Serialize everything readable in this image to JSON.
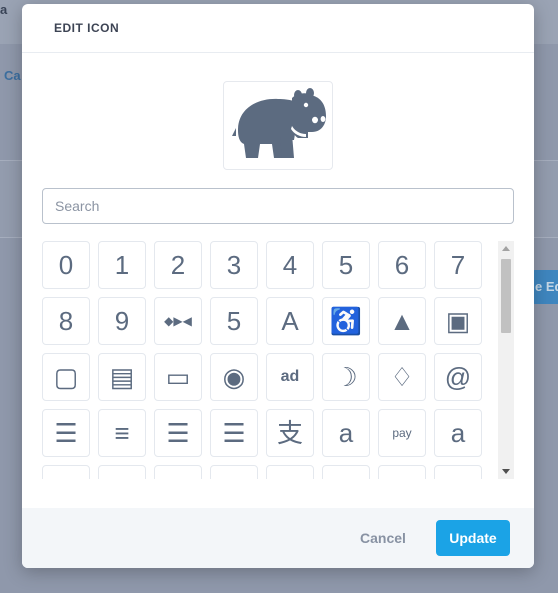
{
  "background": {
    "left_text": "a",
    "cal_text": "Ca",
    "edit_button_text": "e Ed"
  },
  "modal": {
    "title": "EDIT ICON",
    "preview_icon": "hippo-icon",
    "search": {
      "placeholder": "Search",
      "value": ""
    },
    "icons": [
      {
        "name": "digit-0-icon",
        "glyph": "0",
        "kind": "g"
      },
      {
        "name": "digit-1-icon",
        "glyph": "1",
        "kind": "g"
      },
      {
        "name": "digit-2-icon",
        "glyph": "2",
        "kind": "g"
      },
      {
        "name": "digit-3-icon",
        "glyph": "3",
        "kind": "g"
      },
      {
        "name": "digit-4-icon",
        "glyph": "4",
        "kind": "g"
      },
      {
        "name": "digit-5-icon",
        "glyph": "5",
        "kind": "g"
      },
      {
        "name": "digit-6-icon",
        "glyph": "6",
        "kind": "g"
      },
      {
        "name": "digit-7-icon",
        "glyph": "7",
        "kind": "g"
      },
      {
        "name": "digit-8-icon",
        "glyph": "8",
        "kind": "g"
      },
      {
        "name": "digit-9-icon",
        "glyph": "9",
        "kind": "g"
      },
      {
        "name": "42-group-icon",
        "glyph": "◆▶◀",
        "kind": "s"
      },
      {
        "name": "500px-icon",
        "glyph": "5",
        "kind": "g"
      },
      {
        "name": "letter-a-icon",
        "glyph": "A",
        "kind": "g"
      },
      {
        "name": "accessible-icon",
        "glyph": "♿",
        "kind": "g"
      },
      {
        "name": "accusoft-icon",
        "glyph": "▲",
        "kind": "g"
      },
      {
        "name": "address-book-icon",
        "glyph": "▣",
        "kind": "g"
      },
      {
        "name": "address-book-outline-icon",
        "glyph": "▢",
        "kind": "g"
      },
      {
        "name": "address-card-icon",
        "glyph": "▤",
        "kind": "g"
      },
      {
        "name": "address-card-outline-icon",
        "glyph": "▭",
        "kind": "g"
      },
      {
        "name": "adn-icon",
        "glyph": "◉",
        "kind": "g"
      },
      {
        "name": "adversal-icon",
        "glyph": "ad",
        "kind": "t"
      },
      {
        "name": "affiliatetheme-icon",
        "glyph": "☽",
        "kind": "g"
      },
      {
        "name": "airbnb-icon",
        "glyph": "♢",
        "kind": "g"
      },
      {
        "name": "algolia-icon",
        "glyph": "@",
        "kind": "g"
      },
      {
        "name": "align-center-icon",
        "glyph": "☰",
        "kind": "g"
      },
      {
        "name": "align-justify-icon",
        "glyph": "≡",
        "kind": "g"
      },
      {
        "name": "align-left-icon",
        "glyph": "☰",
        "kind": "g"
      },
      {
        "name": "align-right-icon",
        "glyph": "☰",
        "kind": "g"
      },
      {
        "name": "alipay-icon",
        "glyph": "支",
        "kind": "g"
      },
      {
        "name": "amazon-icon",
        "glyph": "a",
        "kind": "g"
      },
      {
        "name": "amazon-pay-icon",
        "glyph": "pay",
        "kind": "s"
      },
      {
        "name": "letter-a-bold-icon",
        "glyph": "a",
        "kind": "g"
      },
      {
        "name": "partial-icon",
        "glyph": "•",
        "kind": "g"
      },
      {
        "name": "partial-icon",
        "glyph": "•",
        "kind": "g"
      },
      {
        "name": "partial-icon",
        "glyph": "•",
        "kind": "g"
      },
      {
        "name": "partial-icon",
        "glyph": "•",
        "kind": "g"
      },
      {
        "name": "partial-icon",
        "glyph": "•",
        "kind": "g"
      },
      {
        "name": "partial-icon",
        "glyph": "",
        "kind": "g"
      },
      {
        "name": "partial-icon",
        "glyph": "",
        "kind": "g"
      },
      {
        "name": "partial-icon",
        "glyph": "",
        "kind": "g"
      }
    ],
    "footer": {
      "cancel_label": "Cancel",
      "update_label": "Update"
    }
  },
  "colors": {
    "accent": "#1ba3e6",
    "icon": "#5c6b80",
    "backdrop": "#8f98ab"
  }
}
